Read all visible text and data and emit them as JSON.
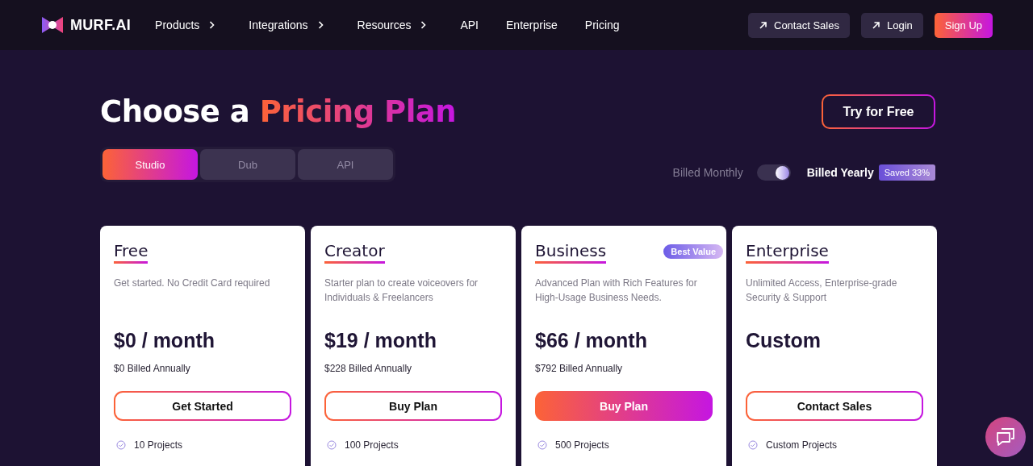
{
  "nav": {
    "logo": "MURF.AI",
    "links": [
      {
        "label": "Products",
        "has_menu": true
      },
      {
        "label": "Integrations",
        "has_menu": true
      },
      {
        "label": "Resources",
        "has_menu": true
      },
      {
        "label": "API",
        "has_menu": false
      },
      {
        "label": "Enterprise",
        "has_menu": false
      },
      {
        "label": "Pricing",
        "has_menu": false
      }
    ],
    "actions": [
      {
        "label": "Contact Sales",
        "kind": "external"
      },
      {
        "label": "Login",
        "kind": "external"
      },
      {
        "label": "Sign Up",
        "kind": "primary"
      }
    ]
  },
  "heading": {
    "text": "Choose a",
    "highlight": "Pricing Plan"
  },
  "try_button": "Try for Free",
  "tabs": [
    {
      "label": "Studio",
      "selected": true
    },
    {
      "label": "Dub",
      "selected": false
    },
    {
      "label": "API",
      "selected": false
    }
  ],
  "billing": {
    "monthly_label": "Billed Monthly",
    "yearly_label": "Billed Yearly",
    "yearly": true,
    "badge": "Saved 33%"
  },
  "plans": [
    {
      "name": "Free",
      "description": "Get started. No Credit Card required",
      "price": "$0 / month",
      "billed": "$0 Billed Annually",
      "button": "Get Started",
      "featured": false,
      "features": [
        "10 Projects"
      ]
    },
    {
      "name": "Creator",
      "description": "Starter plan to create voiceovers for Individuals & Freelancers",
      "price": "$19 / month",
      "billed": "$228 Billed Annually",
      "button": "Buy Plan",
      "featured": false,
      "features": [
        "100 Projects"
      ]
    },
    {
      "name": "Business",
      "badge": "Best Value",
      "description": "Advanced Plan with Rich Features for High-Usage Business Needs.",
      "price": "$66 / month",
      "billed": "$792 Billed Annually",
      "button": "Buy Plan",
      "featured": true,
      "features": [
        "500 Projects"
      ]
    },
    {
      "name": "Enterprise",
      "description": "Unlimited Access, Enterprise-grade Security & Support",
      "price": "Custom",
      "button": "Contact Sales",
      "featured": false,
      "features": [
        "Custom Projects"
      ]
    }
  ]
}
